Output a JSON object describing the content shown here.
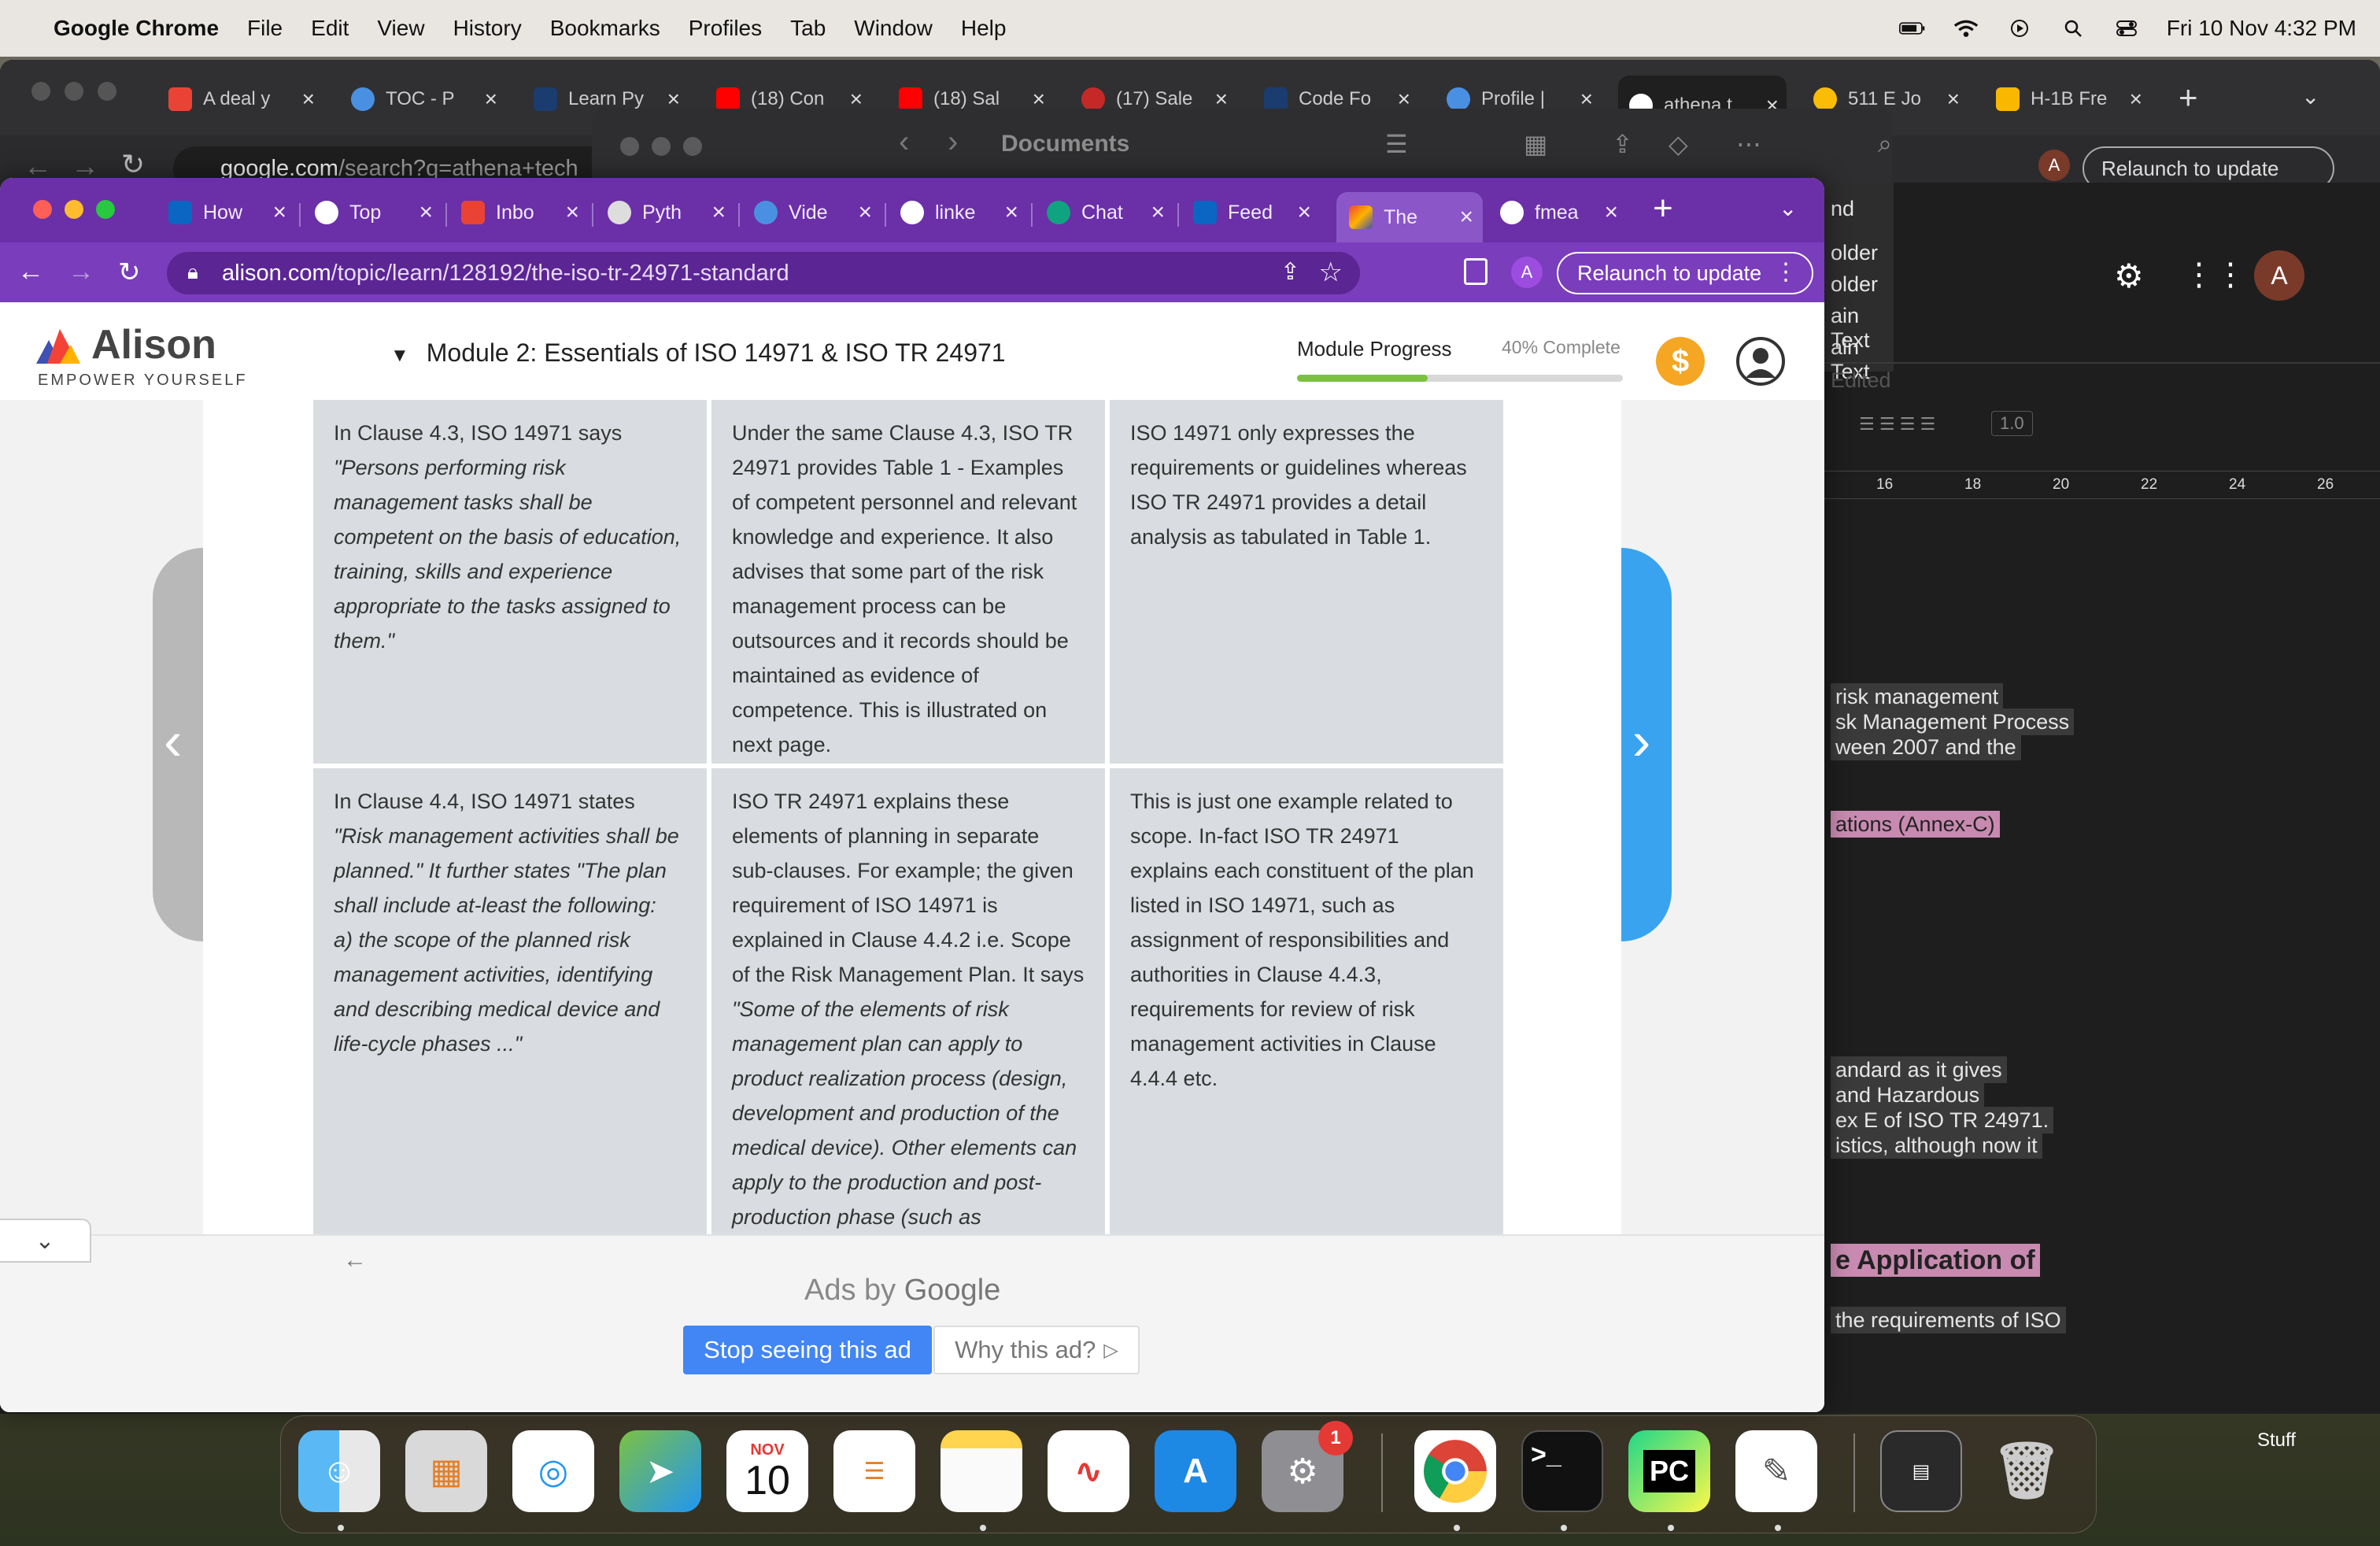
{
  "menubar": {
    "app_name": "Google Chrome",
    "items": [
      "File",
      "Edit",
      "View",
      "History",
      "Bookmarks",
      "Profiles",
      "Tab",
      "Window",
      "Help"
    ],
    "clock": "Fri 10 Nov  4:32 PM"
  },
  "bg_browser": {
    "tabs": [
      "A deal y",
      "TOC - P",
      "Learn Py",
      "(18) Con",
      "(18) Sal",
      "(17) Sale",
      "Code Fo",
      "Profile |",
      "athena t",
      "511 E Jo",
      "H-1B Fre"
    ],
    "url_host": "google.com",
    "url_path": "/search?q=athena+tech",
    "relaunch_label": "Relaunch to update"
  },
  "finder": {
    "title": "Documents"
  },
  "right_panel": {
    "sidebar_items": [
      "nd",
      "older",
      "older",
      "ain Text",
      "ain Text"
    ],
    "edited": "Edited",
    "line_spacing": "1.0",
    "ruler_ticks": [
      "16",
      "18",
      "20",
      "22",
      "24",
      "26"
    ],
    "lines": [
      "risk management",
      "sk Management Process",
      "ween 2007 and the",
      "ations (Annex-C)",
      "andard as it gives",
      "and Hazardous",
      "ex E of ISO TR 24971.",
      "istics, although now it",
      "e Application of",
      "the requirements of ISO"
    ],
    "avatar": "A"
  },
  "browser": {
    "tabs": [
      "How",
      "Top",
      "Inbo",
      "Pyth",
      "Vide",
      "linke",
      "Chat",
      "Feed",
      "The",
      "fmea"
    ],
    "active_tab_index": 8,
    "url_host": "alison.com",
    "url_path": "/topic/learn/128192/the-iso-tr-24971-standard",
    "profile_letter": "A",
    "relaunch_label": "Relaunch to update"
  },
  "site": {
    "logo": "Alison",
    "tagline": "EMPOWER YOURSELF",
    "module_title": "Module 2: Essentials of ISO 14971 & ISO TR 24971",
    "progress_label": "Module Progress",
    "progress_text": "40% Complete",
    "progress_fraction": 0.4,
    "coin_symbol": "$"
  },
  "lesson": {
    "row1": {
      "c1_plain": "In Clause 4.3, ISO 14971 says",
      "c1_italic": "\"Persons performing risk management tasks shall be competent on the basis of education, training, skills and experience appropriate to the tasks assigned to them.\"",
      "c2": "Under the same Clause 4.3, ISO TR 24971 provides Table 1 - Examples of competent personnel and relevant knowledge and experience. It also advises that some part of the risk management process can be outsources and it records should be maintained as evidence of competence. This is illustrated on next page.",
      "c3": "ISO 14971 only expresses the requirements or guidelines whereas ISO TR 24971 provides a detail analysis as tabulated in Table 1."
    },
    "row2": {
      "c1_plain": "In Clause 4.4, ISO 14971 states",
      "c1_italic": "\"Risk management activities shall be planned.\" It further states \"The plan shall include at-least the following:",
      "c1_item": "a) the scope of the planned risk management activities, identifying and describing medical device and life-cycle phases ...\"",
      "c2_plain": "ISO TR 24971 explains these elements of planning in separate sub-clauses. For example; the given requirement of ISO 14971 is explained in Clause 4.4.2 i.e. Scope of the Risk Management Plan. It says",
      "c2_italic": "\"Some of the elements of risk management plan can apply to product realization process (design, development and production of the medical device). Other elements can apply to the production and post-production phase (such as",
      "c3": "This is just one example related to scope. In-fact ISO TR 24971 explains each constituent of the plan listed in ISO 14971, such as assignment of responsibilities and authorities in Clause 4.4.3, requirements for review of risk management activities in Clause 4.4.4 etc."
    }
  },
  "ad": {
    "ads_by": "Ads by",
    "google": "Google",
    "stop_label": "Stop seeing this ad",
    "why_label": "Why this ad?"
  },
  "dock": {
    "calendar_month": "NOV",
    "calendar_day": "10",
    "settings_badge": "1",
    "stack_label": "Stuff"
  },
  "colors": {
    "chrome_purple": "#6b2fa8",
    "progress_green": "#7cc142",
    "next_blue": "#3aa3f0",
    "ad_blue": "#4285f4"
  }
}
